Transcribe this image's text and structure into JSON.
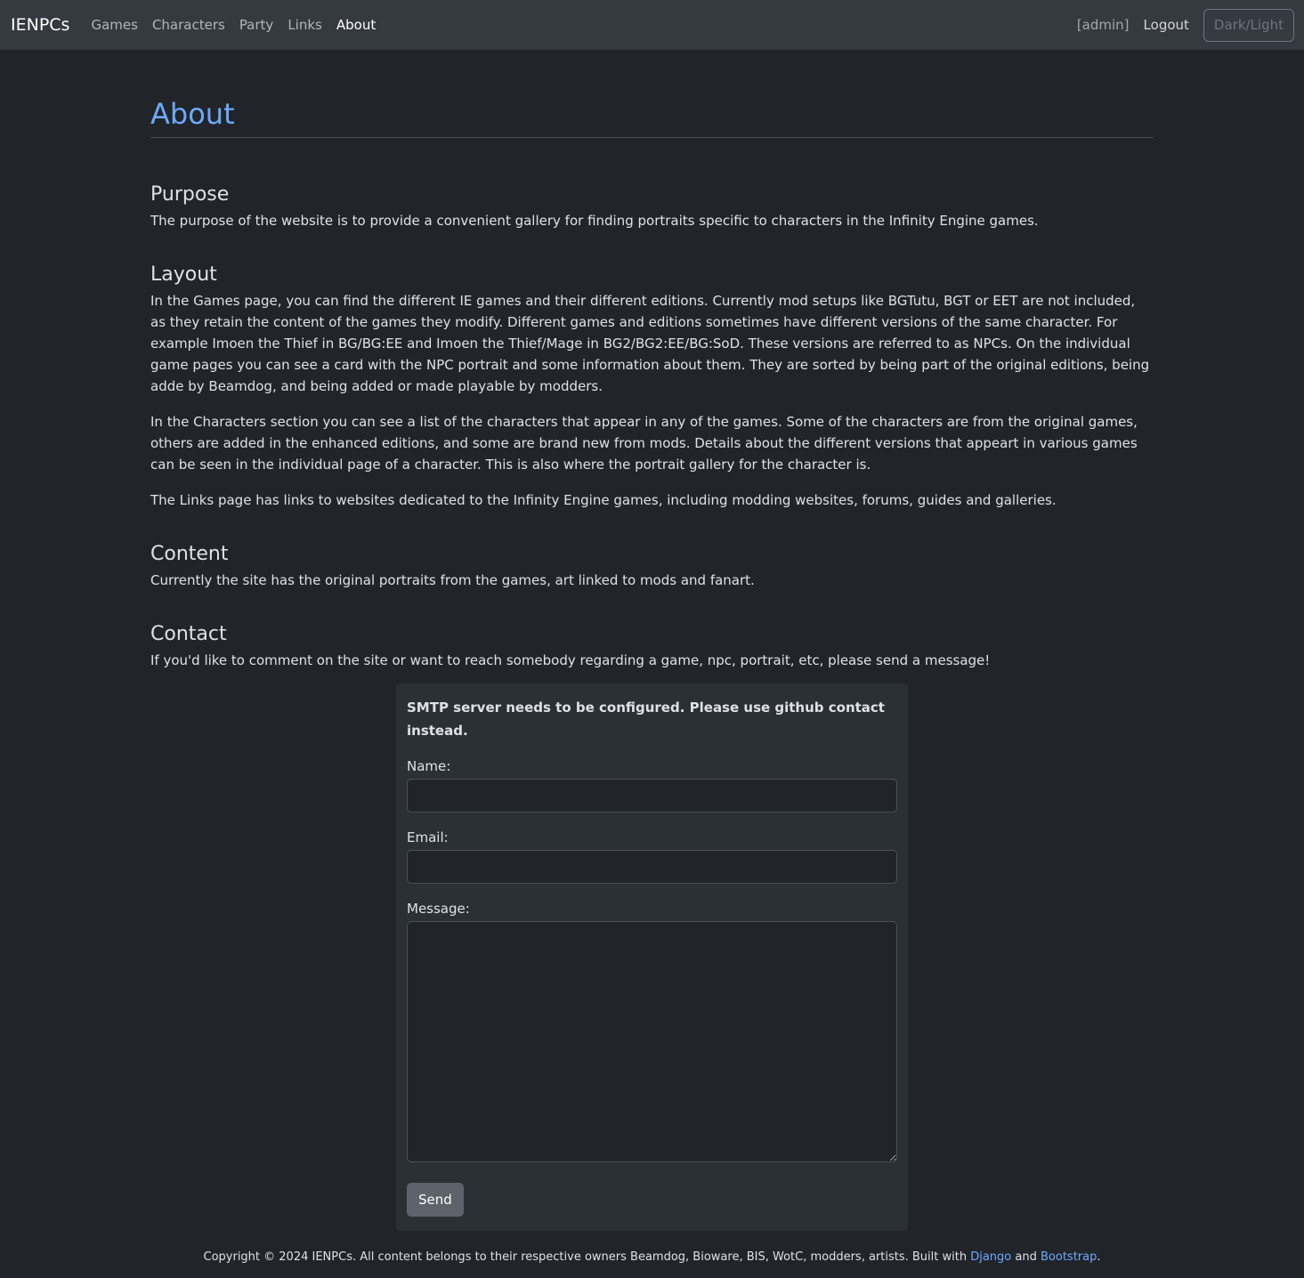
{
  "nav": {
    "brand": "IENPCs",
    "links": [
      "Games",
      "Characters",
      "Party",
      "Links",
      "About"
    ],
    "active": "About",
    "admin": "[admin]",
    "logout": "Logout",
    "theme_toggle": "Dark/Light"
  },
  "page": {
    "title": "About",
    "sections": {
      "purpose": {
        "heading": "Purpose",
        "paragraphs": [
          "The purpose of the website is to provide a convenient gallery for finding portraits specific to characters in the Infinity Engine games."
        ]
      },
      "layout": {
        "heading": "Layout",
        "paragraphs": [
          "In the Games page, you can find the different IE games and their different editions. Currently mod setups like BGTutu, BGT or EET are not included, as they retain the content of the games they modify. Different games and editions sometimes have different versions of the same character. For example Imoen the Thief in BG/BG:EE and Imoen the Thief/Mage in BG2/BG2:EE/BG:SoD. These versions are referred to as NPCs. On the individual game pages you can see a card with the NPC portrait and some information about them. They are sorted by being part of the original editions, being adde by Beamdog, and being added or made playable by modders.",
          "In the Characters section you can see a list of the characters that appear in any of the games. Some of the characters are from the original games, others are added in the enhanced editions, and some are brand new from mods. Details about the different versions that appeart in various games can be seen in the individual page of a character. This is also where the portrait gallery for the character is.",
          "The Links page has links to websites dedicated to the Infinity Engine games, including modding websites, forums, guides and galleries."
        ]
      },
      "content": {
        "heading": "Content",
        "paragraphs": [
          "Currently the site has the original portraits from the games, art linked to mods and fanart."
        ]
      },
      "contact": {
        "heading": "Contact",
        "paragraphs": [
          "If you'd like to comment on the site or want to reach somebody regarding a game, npc, portrait, etc, please send a message!"
        ]
      }
    }
  },
  "form": {
    "warning": "SMTP server needs to be configured. Please use github contact instead.",
    "name_label": "Name:",
    "name_value": "",
    "email_label": "Email:",
    "email_value": "",
    "message_label": "Message:",
    "message_value": "",
    "submit": "Send"
  },
  "footer": {
    "text": "Copyright © 2024 IENPCs. All content belongs to their respective owners Beamdog, Bioware, BIS, WotC, modders, artists. Built with ",
    "django": "Django",
    "and": " and ",
    "bootstrap": "Bootstrap",
    "end": "."
  },
  "colors": {
    "background": "#212529",
    "navbar": "#343a40",
    "accent": "#6ea8fe",
    "card": "#2b3035",
    "button": "#5c636a"
  }
}
